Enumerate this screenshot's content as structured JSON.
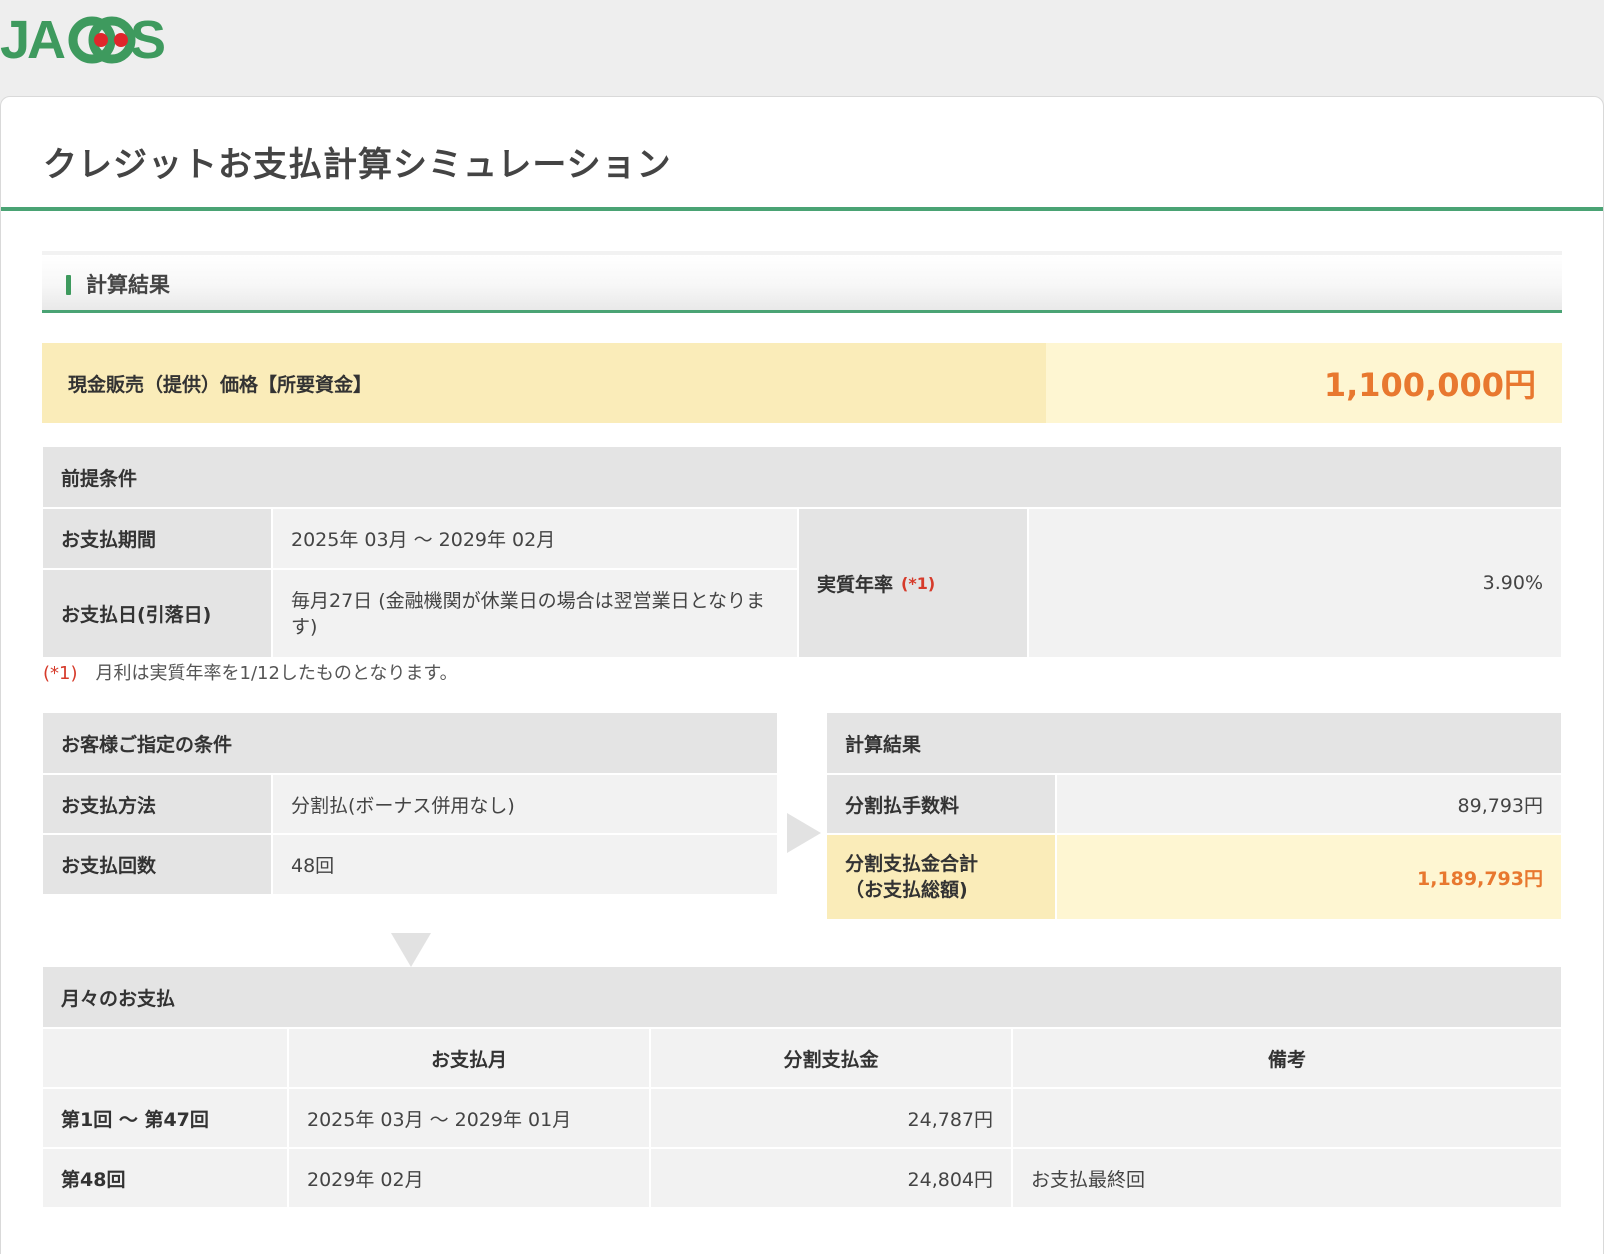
{
  "brand": {
    "logo_text": "JACCS",
    "green": "#3e9a5e",
    "red": "#e0262b"
  },
  "page": {
    "title": "クレジットお支払計算シミュレーション"
  },
  "section": {
    "title": "計算結果"
  },
  "price": {
    "label": "現金販売（提供）価格【所要資金】",
    "value": "1,100,000円",
    "accent": "#e8782f"
  },
  "premise": {
    "header": "前提条件",
    "period_label": "お支払期間",
    "period_value": "2025年 03月 〜 2029年 02月",
    "payday_label": "お支払日(引落日)",
    "payday_value": "毎月27日 (金融機関が休業日の場合は翌営業日となります)",
    "rate_label": "実質年率",
    "rate_mark": "(*1)",
    "rate_value": "3.90%"
  },
  "note": {
    "mark": "(*1)",
    "text": "月利は実質年率を1/12したものとなります。"
  },
  "customer": {
    "header": "お客様ご指定の条件",
    "method_label": "お支払方法",
    "method_value": "分割払(ボーナス併用なし)",
    "count_label": "お支払回数",
    "count_value": "48回"
  },
  "result": {
    "header": "計算結果",
    "fee_label": "分割払手数料",
    "fee_value": "89,793円",
    "total_label_1": "分割支払金合計",
    "total_label_2": "（お支払総額)",
    "total_value": "1,189,793円"
  },
  "monthly": {
    "header": "月々のお支払",
    "columns": [
      "",
      "お支払月",
      "分割支払金",
      "備考"
    ],
    "rows": [
      {
        "no": "第1回 〜 第47回",
        "month": "2025年 03月 〜 2029年 01月",
        "amount": "24,787円",
        "remark": ""
      },
      {
        "no": "第48回",
        "month": "2029年 02月",
        "amount": "24,804円",
        "remark": "お支払最終回"
      }
    ]
  }
}
